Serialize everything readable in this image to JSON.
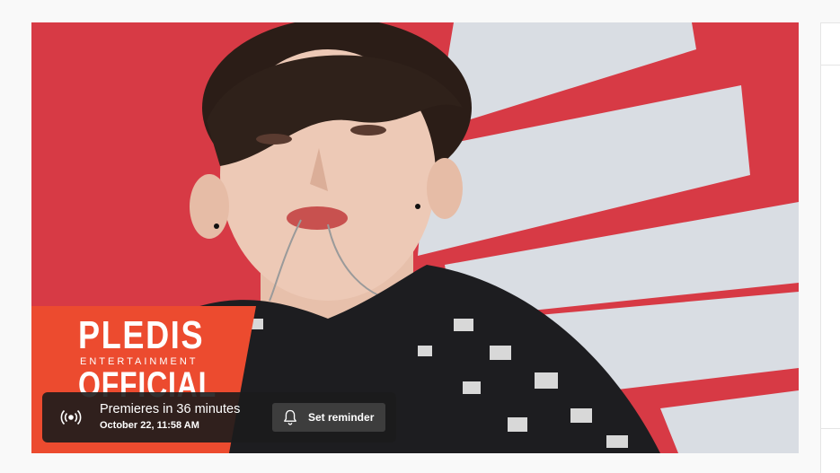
{
  "player": {
    "thumbnail_logo": {
      "brand": "PLEDIS",
      "subtitle": "ENTERTAINMENT",
      "tag": "OFFICIAL"
    },
    "premiere": {
      "icon": "live-broadcast-icon",
      "status": "Premieres in 36 minutes",
      "date": "October 22, 11:58 AM",
      "reminder_icon": "bell-icon",
      "reminder_label": "Set reminder"
    }
  },
  "colors": {
    "background": "#f9f9f9",
    "thumbnail_red": "#d73a45",
    "logo_orange": "#ec4b2f",
    "overlay": "#1c1c1c",
    "button": "#3d3d3d"
  }
}
